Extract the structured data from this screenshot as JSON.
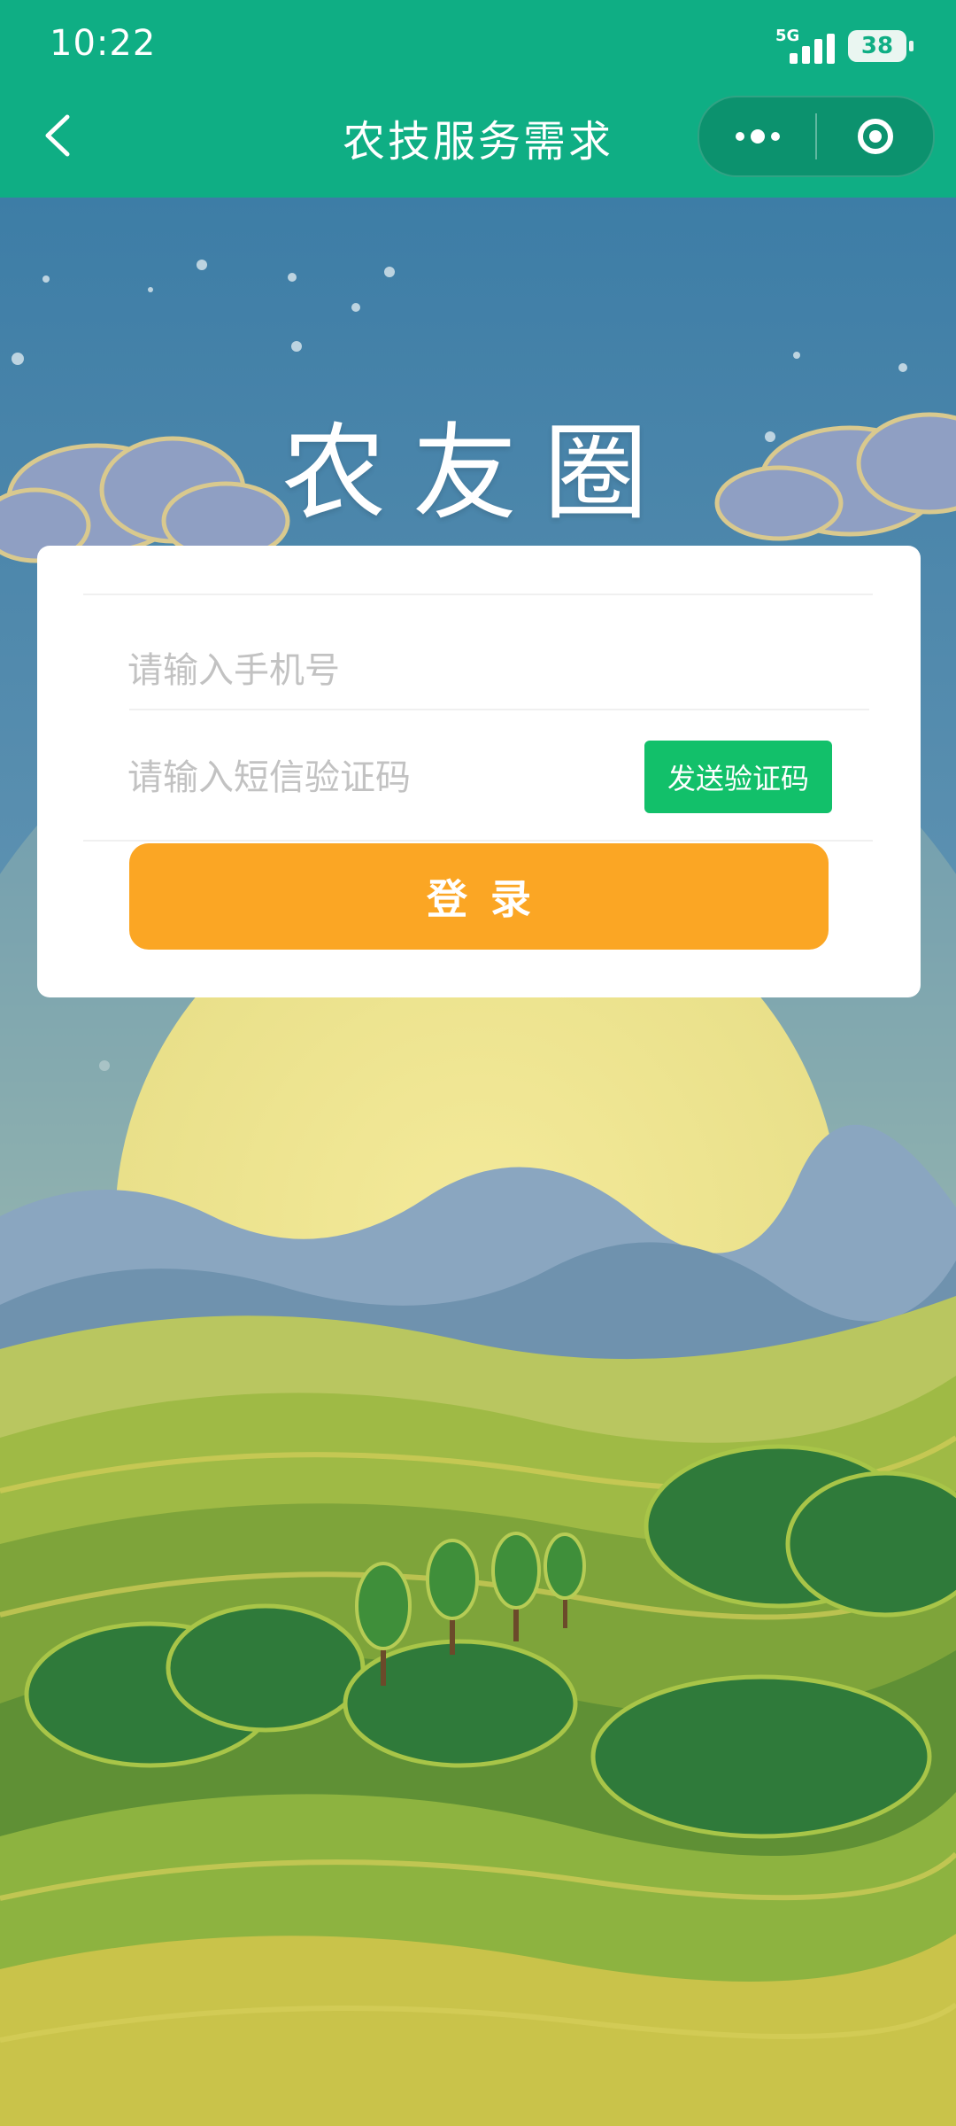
{
  "status_bar": {
    "time": "10:22",
    "network": "5G",
    "battery": "38"
  },
  "nav": {
    "title": "农技服务需求"
  },
  "brand": {
    "title": "农友圈"
  },
  "form": {
    "phone_placeholder": "请输入手机号",
    "code_placeholder": "请输入短信验证码",
    "send_code_label": "发送验证码",
    "login_label": "登录"
  },
  "colors": {
    "header": "#0fae84",
    "send_button": "#12c06a",
    "login_button": "#fba624"
  },
  "icons": [
    "back-icon",
    "more-icon",
    "target-icon",
    "signal-icon",
    "battery-icon"
  ]
}
